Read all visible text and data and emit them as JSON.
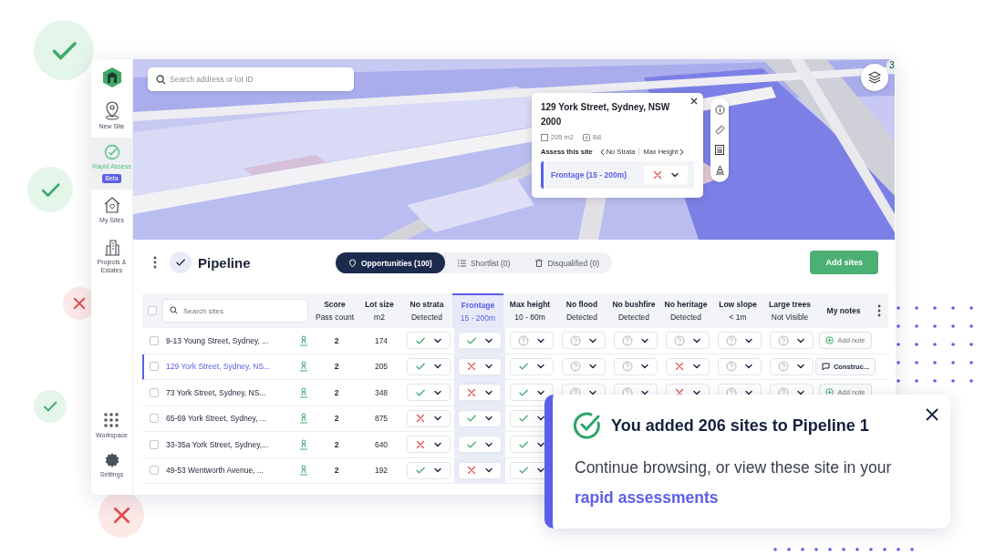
{
  "decor_badges": [
    {
      "kind": "check"
    },
    {
      "kind": "check"
    },
    {
      "kind": "cross"
    },
    {
      "kind": "check"
    },
    {
      "kind": "cross"
    }
  ],
  "sidebar": {
    "items": [
      {
        "label": "New Site",
        "selected": false
      },
      {
        "label": "Rapid Assess",
        "selected": true,
        "badge": "Beta"
      },
      {
        "label": "My Sites",
        "selected": false
      },
      {
        "label": "Projects & Estates",
        "selected": false
      }
    ],
    "bottom_items": [
      {
        "label": "Workspace",
        "selected": false
      },
      {
        "label": "Settings",
        "selected": false
      }
    ]
  },
  "map": {
    "search": {
      "placeholder": "Search address or lot ID"
    },
    "layers_count": "3",
    "popup": {
      "title": "129 York Street, Sydney, NSW 2000",
      "area": "205 m2",
      "zone": "B8",
      "assess_label": "Assess this site",
      "prev": "No Strata",
      "next": "Max Height",
      "criterion": {
        "label": "Frontage (15 - 200m)",
        "kind": "fail"
      }
    }
  },
  "pipeline": {
    "title": "Pipeline",
    "tabs": [
      {
        "label": "Opportunities (100)",
        "selected": true
      },
      {
        "label": "Shortlist (0)",
        "selected": false
      },
      {
        "label": "Disqualified (0)",
        "selected": false
      }
    ],
    "button": "Add sites"
  },
  "table": {
    "select_all": {
      "checked": false
    },
    "search": {
      "placeholder": "Search sites"
    },
    "columns": [
      {
        "title": "Score",
        "subtitle": "Pass count",
        "selected": false
      },
      {
        "title": "Lot size",
        "subtitle": "m2",
        "selected": false
      },
      {
        "title": "No strata",
        "subtitle": "Detected",
        "selected": false
      },
      {
        "title": "Frontage",
        "subtitle": "15 - 200m",
        "selected": true
      },
      {
        "title": "Max height",
        "subtitle": "10 - 80m",
        "selected": false
      },
      {
        "title": "No flood",
        "subtitle": "Detected",
        "selected": false
      },
      {
        "title": "No bushfire",
        "subtitle": "Detected",
        "selected": false
      },
      {
        "title": "No heritage",
        "subtitle": "Detected",
        "selected": false
      },
      {
        "title": "Low slope",
        "subtitle": "< 1m",
        "selected": false
      },
      {
        "title": "Large trees",
        "subtitle": "Not Visible",
        "selected": false
      },
      {
        "title": "My notes",
        "selected": false
      }
    ],
    "rows": [
      {
        "name": "9-13 Young Street, Sydney, ...",
        "selected": false,
        "checked": false,
        "score": "2",
        "lot_size": "174",
        "checks": [
          {
            "kind": "pass"
          },
          {
            "kind": "pass"
          },
          {
            "kind": "unknown"
          },
          {
            "kind": "unknown"
          },
          {
            "kind": "unknown"
          },
          {
            "kind": "unknown"
          },
          {
            "kind": "unknown"
          },
          {
            "kind": "unknown"
          }
        ],
        "note": {
          "kind": "add",
          "label": "Add note"
        }
      },
      {
        "name": "129 York Street, Sydney, NS...",
        "selected": true,
        "checked": false,
        "score": "2",
        "lot_size": "205",
        "checks": [
          {
            "kind": "pass"
          },
          {
            "kind": "fail"
          },
          {
            "kind": "pass"
          },
          {
            "kind": "unknown"
          },
          {
            "kind": "unknown"
          },
          {
            "kind": "fail"
          },
          {
            "kind": "unknown"
          },
          {
            "kind": "unknown"
          }
        ],
        "note": {
          "kind": "comment",
          "label": "Construc..."
        }
      },
      {
        "name": "73 York Street, Sydney, NS...",
        "selected": false,
        "checked": false,
        "score": "2",
        "lot_size": "348",
        "checks": [
          {
            "kind": "pass"
          },
          {
            "kind": "fail"
          },
          {
            "kind": "pass"
          },
          {
            "kind": "unknown"
          },
          {
            "kind": "unknown"
          },
          {
            "kind": "fail"
          },
          {
            "kind": "unknown"
          },
          {
            "kind": "unknown"
          }
        ],
        "note": {
          "kind": "add",
          "label": "Add note"
        }
      },
      {
        "name": "65-69 York Street, Sydney, ...",
        "selected": false,
        "checked": false,
        "score": "2",
        "lot_size": "875",
        "checks": [
          {
            "kind": "fail"
          },
          {
            "kind": "pass"
          },
          {
            "kind": "pass"
          }
        ]
      },
      {
        "name": "33-35a York Street, Sydney,...",
        "selected": false,
        "checked": false,
        "score": "2",
        "lot_size": "640",
        "checks": [
          {
            "kind": "fail"
          },
          {
            "kind": "pass"
          },
          {
            "kind": "pass"
          }
        ]
      },
      {
        "name": "49-53 Wentworth Avenue, ...",
        "selected": false,
        "checked": false,
        "score": "2",
        "lot_size": "192",
        "checks": [
          {
            "kind": "pass"
          },
          {
            "kind": "fail"
          },
          {
            "kind": "pass"
          }
        ]
      }
    ]
  },
  "toast": {
    "title": "You added 206 sites to Pipeline 1",
    "message": "Continue browsing, or view these site in your",
    "link": "rapid assessments"
  }
}
